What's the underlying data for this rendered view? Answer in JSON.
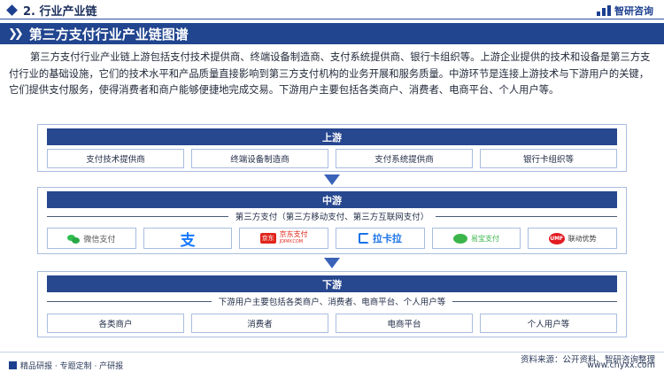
{
  "header": {
    "section_title": "2. 行业产业链",
    "brand": "智研咨询"
  },
  "banner": {
    "title": "第三方支付行业产业链图谱"
  },
  "intro": "第三方支付行业产业链上游包括支付技术提供商、终端设备制造商、支付系统提供商、银行卡组织等。上游企业提供的技术和设备是第三方支付行业的基础设施，它们的技术水平和产品质量直接影响到第三方支付机构的业务开展和服务质量。中游环节是连接上游技术与下游用户的关键，它们提供支付服务，使得消费者和商户能够便捷地完成交易。下游用户主要包括各类商户、消费者、电商平台、个人用户等。",
  "diagram": {
    "upstream": {
      "title": "上游",
      "items": [
        "支付技术提供商",
        "终端设备制造商",
        "支付系统提供商",
        "银行卡组织等"
      ]
    },
    "midstream": {
      "title": "中游",
      "subtitle": "第三方支付（第三方移动支付、第三方互联网支付）",
      "logos": [
        {
          "name": "wechat-pay-logo",
          "text": "微信支付",
          "color": "#2fbf4f"
        },
        {
          "name": "alipay-logo",
          "text": "支",
          "color": "#1677ff"
        },
        {
          "name": "jd-pay-logo",
          "text": "京东支付",
          "sub": "JDPAY.COM",
          "color": "#e1251b"
        },
        {
          "name": "lakala-logo",
          "text": "拉卡拉",
          "color": "#1a73e8"
        },
        {
          "name": "yeepay-logo",
          "text": "易宝支付",
          "color": "#3bb54a"
        },
        {
          "name": "umf-logo",
          "text": "联动优势",
          "mark": "UMF",
          "color": "#e31b23"
        }
      ]
    },
    "downstream": {
      "title": "下游",
      "subtitle": "下游用户主要包括各类商户、消费者、电商平台、个人用户等",
      "items": [
        "各类商户",
        "消费者",
        "电商平台",
        "个人用户等"
      ]
    }
  },
  "footer": {
    "left": "精品研报 · 专题定制 · 产研报",
    "source": "资料来源：公开资料、智研咨询整理",
    "site": "www.chyxx.com"
  }
}
